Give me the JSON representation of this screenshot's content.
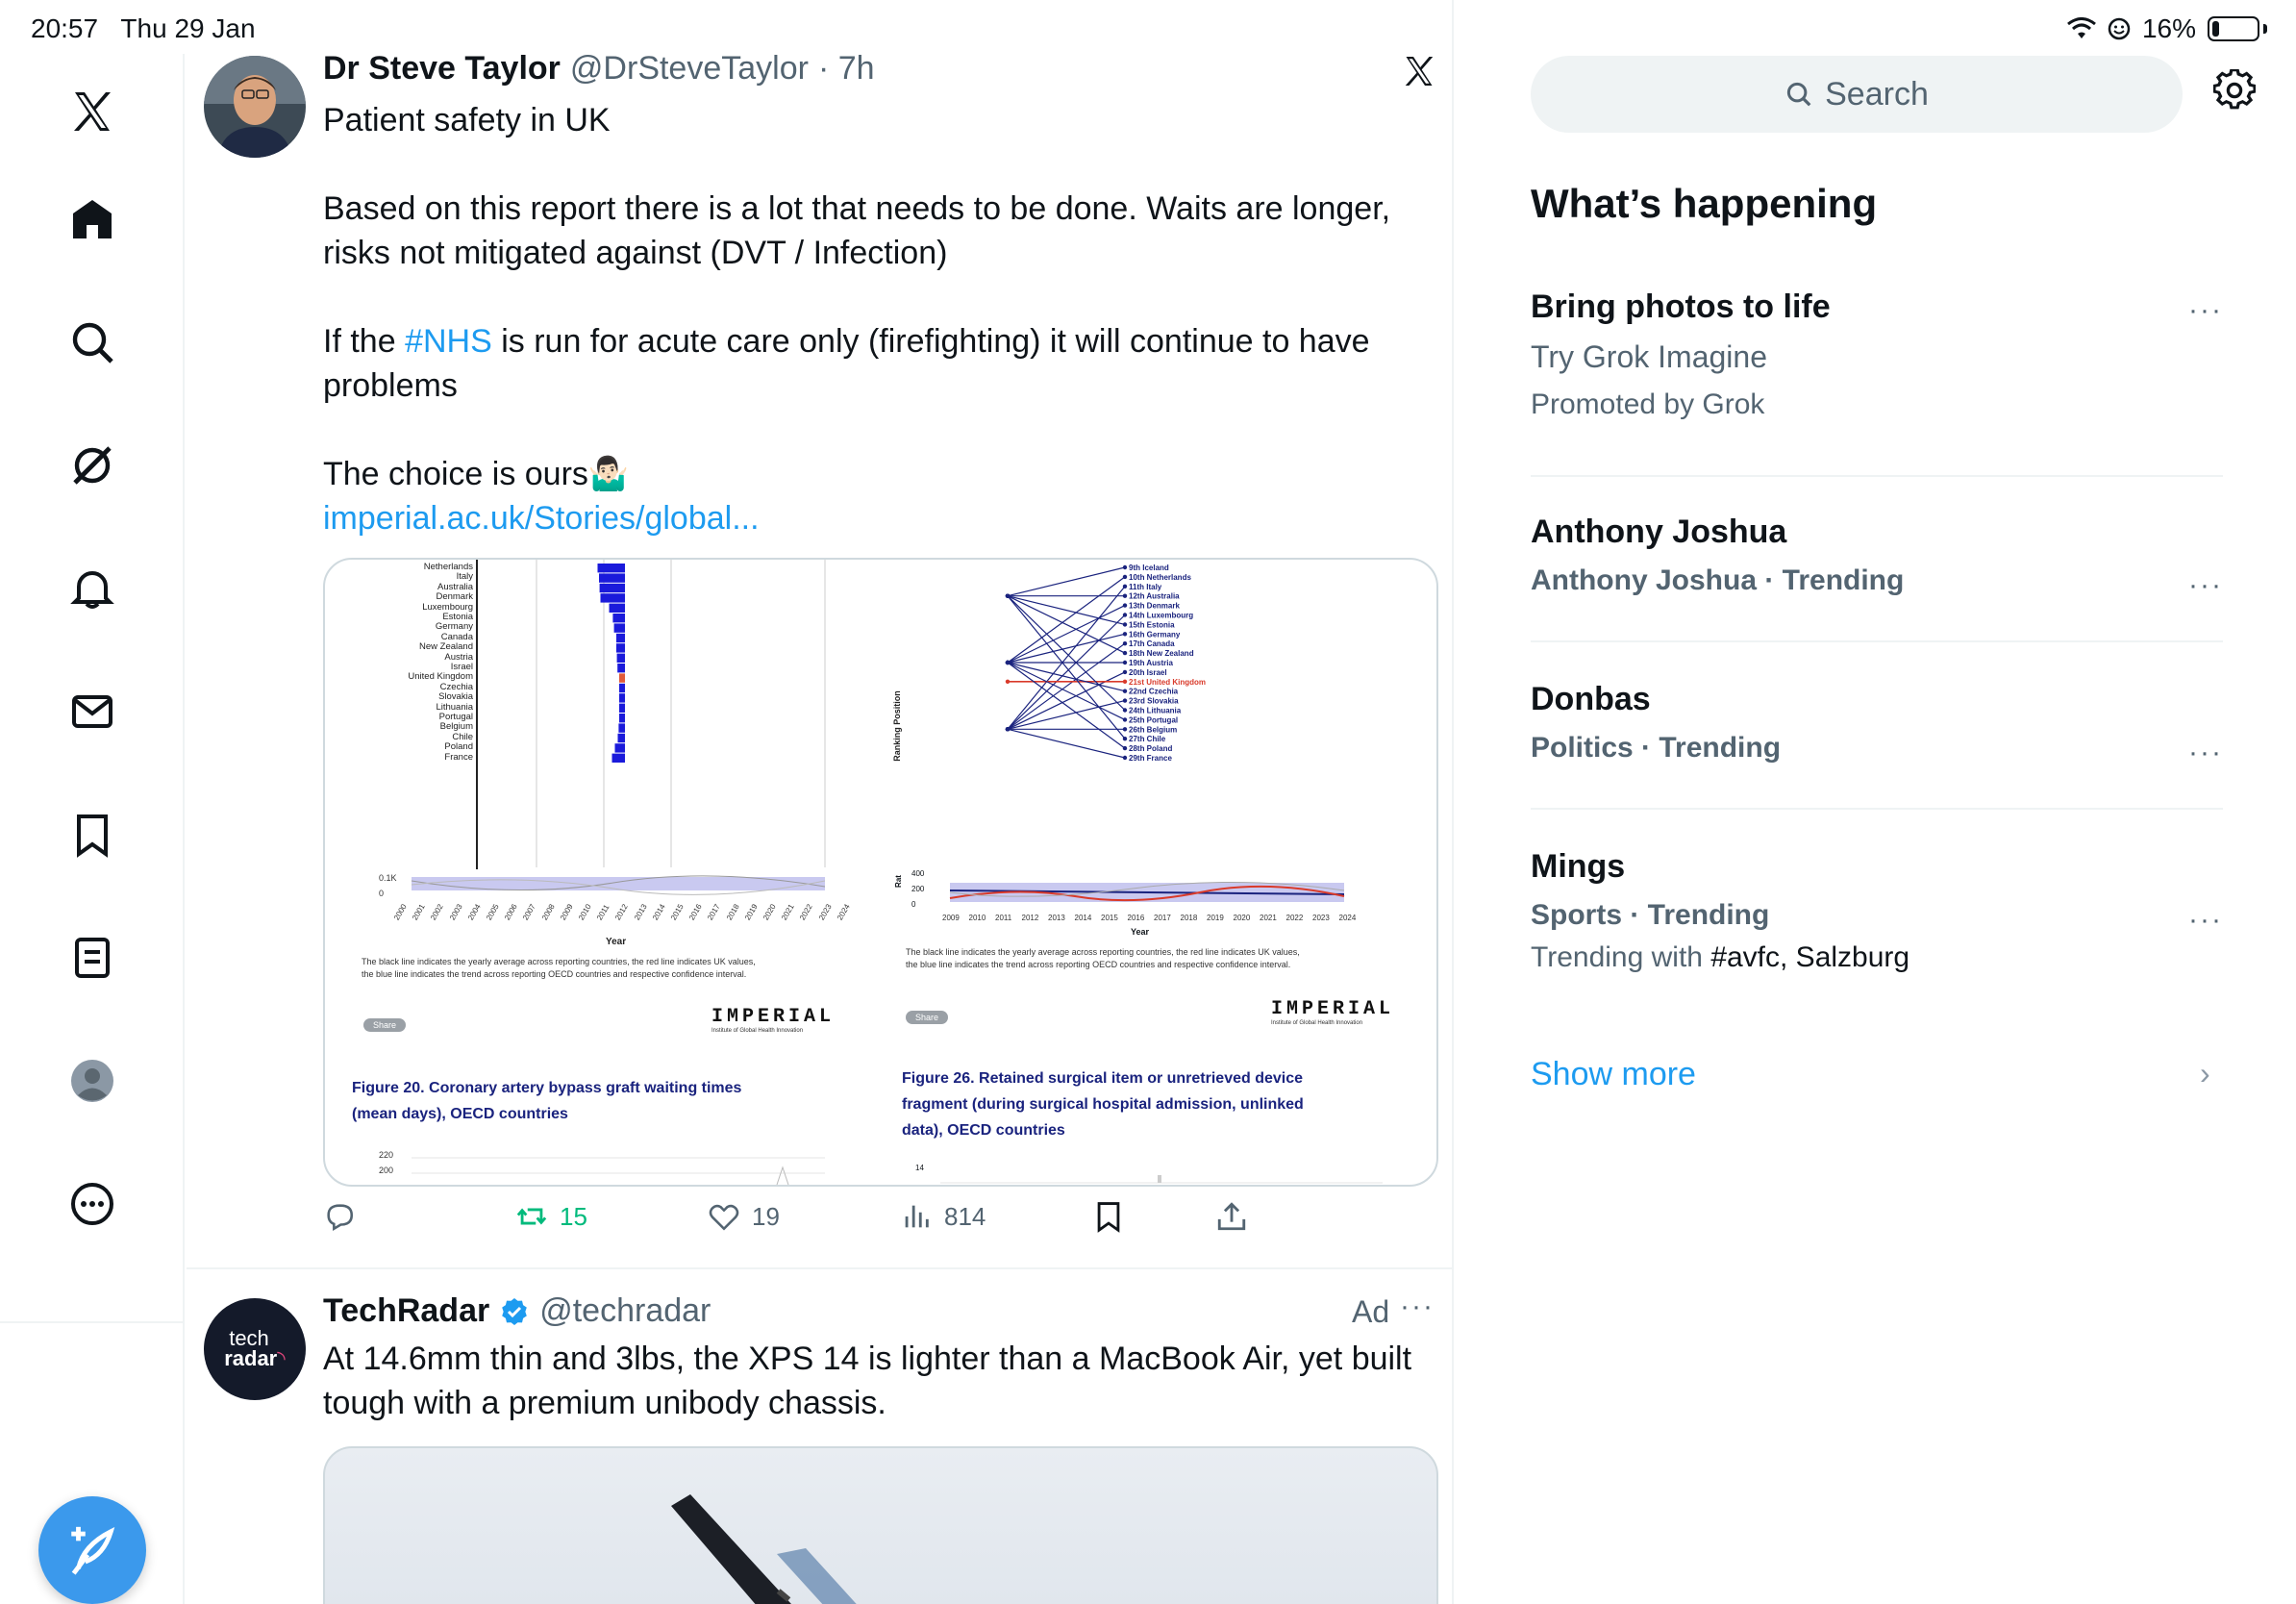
{
  "status_bar": {
    "time": "20:57",
    "date": "Thu 29 Jan",
    "battery": "16%",
    "battery_level": 0.16
  },
  "nav": {
    "items": [
      "x-logo-icon",
      "home-icon",
      "search-icon",
      "grok-icon",
      "notifications-icon",
      "messages-icon",
      "bookmarks-icon",
      "lists-icon",
      "profile-icon",
      "more-icon"
    ],
    "compose_icon": "compose-post-icon",
    "accent": "#3b99ec"
  },
  "tweet1": {
    "name": "Dr Steve Taylor",
    "handle": "@DrSteveTaylor",
    "time": "· 7h",
    "line1": "Patient safety in UK",
    "line2": "Based on this report there is a lot that needs to be done. Waits are longer,",
    "line3": "risks not mitigated against (DVT / Infection)",
    "line4_pre": "If the ",
    "hashtag": "#NHS",
    "line4_post": " is run for acute care only (firefighting) it will continue to have",
    "line5": "problems",
    "line6": "The choice is ours",
    "emoji": "🤷🏻‍♂️",
    "link": "imperial.ac.uk/Stories/global...",
    "actions": {
      "reposts": "15",
      "likes": "19",
      "views": "814"
    },
    "repost_color": "#00ba7c"
  },
  "media": {
    "left": {
      "countries": [
        "Netherlands",
        "Italy",
        "Australia",
        "Denmark",
        "Luxembourg",
        "Estonia",
        "Germany",
        "Canada",
        "New Zealand",
        "Austria",
        "Israel",
        "United Kingdom",
        "Czechia",
        "Slovakia",
        "Lithuania",
        "Portugal",
        "Belgium",
        "Chile",
        "Poland",
        "France"
      ],
      "bar_values": [
        0.95,
        0.9,
        0.88,
        0.85,
        0.55,
        0.42,
        0.38,
        0.3,
        0.3,
        0.28,
        0.26,
        0.1,
        0.08,
        0.07,
        0.18,
        0.2,
        0.22,
        0.25,
        0.35,
        0.45
      ],
      "highlight": "United Kingdom",
      "yticks": [
        "0.1K",
        "0"
      ],
      "years": [
        "2000",
        "2001",
        "2002",
        "2003",
        "2004",
        "2005",
        "2006",
        "2007",
        "2008",
        "2009",
        "2010",
        "2011",
        "2012",
        "2013",
        "2014",
        "2015",
        "2016",
        "2017",
        "2018",
        "2019",
        "2020",
        "2021",
        "2022",
        "2023",
        "2024"
      ],
      "xlabel": "Year",
      "note1": "The black line indicates the yearly average across reporting countries, the red line indicates UK values,",
      "note2": "the blue line indicates the trend across reporting OECD countries and respective confidence interval.",
      "share": "Share",
      "brand": "IMPERIAL",
      "brand_sub": "Institute of Global Health Innovation",
      "caption1": "Figure 20. Coronary artery bypass graft waiting times",
      "caption2": "(mean days), OECD countries",
      "next_ticks": [
        "220",
        "200"
      ]
    },
    "right": {
      "ranks": [
        "9th Iceland",
        "10th Netherlands",
        "11th Italy",
        "12th Australia",
        "13th Denmark",
        "14th Luxembourg",
        "15th Estonia",
        "16th Germany",
        "17th Canada",
        "18th New Zealand",
        "19th Austria",
        "20th Israel",
        "21st United Kingdom",
        "22nd Czechia",
        "23rd Slovakia",
        "24th Lithuania",
        "25th Portugal",
        "26th Belgium",
        "27th Chile",
        "28th Poland",
        "29th France"
      ],
      "highlight": "21st United Kingdom",
      "ylabel": "Ranking Position",
      "rate_label": "Rat",
      "yticks": [
        "400",
        "200",
        "0"
      ],
      "years": [
        "2009",
        "2010",
        "2011",
        "2012",
        "2013",
        "2014",
        "2015",
        "2016",
        "2017",
        "2018",
        "2019",
        "2020",
        "2021",
        "2022",
        "2023",
        "2024"
      ],
      "xlabel": "Year",
      "note1": "The black line indicates the yearly average across reporting countries, the red line indicates UK values,",
      "note2": "the blue line indicates the trend across reporting OECD countries and respective confidence interval.",
      "share": "Share",
      "brand": "IMPERIAL",
      "brand_sub": "Institute of Global Health Innovation",
      "caption1": "Figure 26. Retained surgical item or unretrieved device",
      "caption2": "fragment (during surgical hospital admission, unlinked",
      "caption3": "data), OECD countries",
      "next_tick": "14"
    },
    "bar_color": "#1a1adb",
    "uk_color": "#e15a3a"
  },
  "tweet2": {
    "name": "TechRadar",
    "handle": "@techradar",
    "ad": "Ad",
    "avatar_line1": "tech",
    "avatar_line2": "radar",
    "text1": "At 14.6mm thin and 3lbs, the XPS 14 is lighter than a MacBook Air, yet built",
    "text2": "tough with a premium unibody chassis."
  },
  "sidebar": {
    "search_placeholder": "Search",
    "heading": "What’s happening",
    "trends": [
      {
        "title": "Bring photos to life",
        "sub": "Try Grok Imagine",
        "meta": "Promoted by Grok"
      },
      {
        "title": "Anthony Joshua",
        "meta": "Anthony Joshua · Trending"
      },
      {
        "title": "Donbas",
        "meta": "Politics · Trending"
      },
      {
        "title": "Mings",
        "meta": "Sports · Trending",
        "extra_pre": "Trending with ",
        "extra_tags": "#avfc, Salzburg"
      }
    ],
    "dots": "···",
    "show_more": "Show more",
    "chevron": "›"
  }
}
